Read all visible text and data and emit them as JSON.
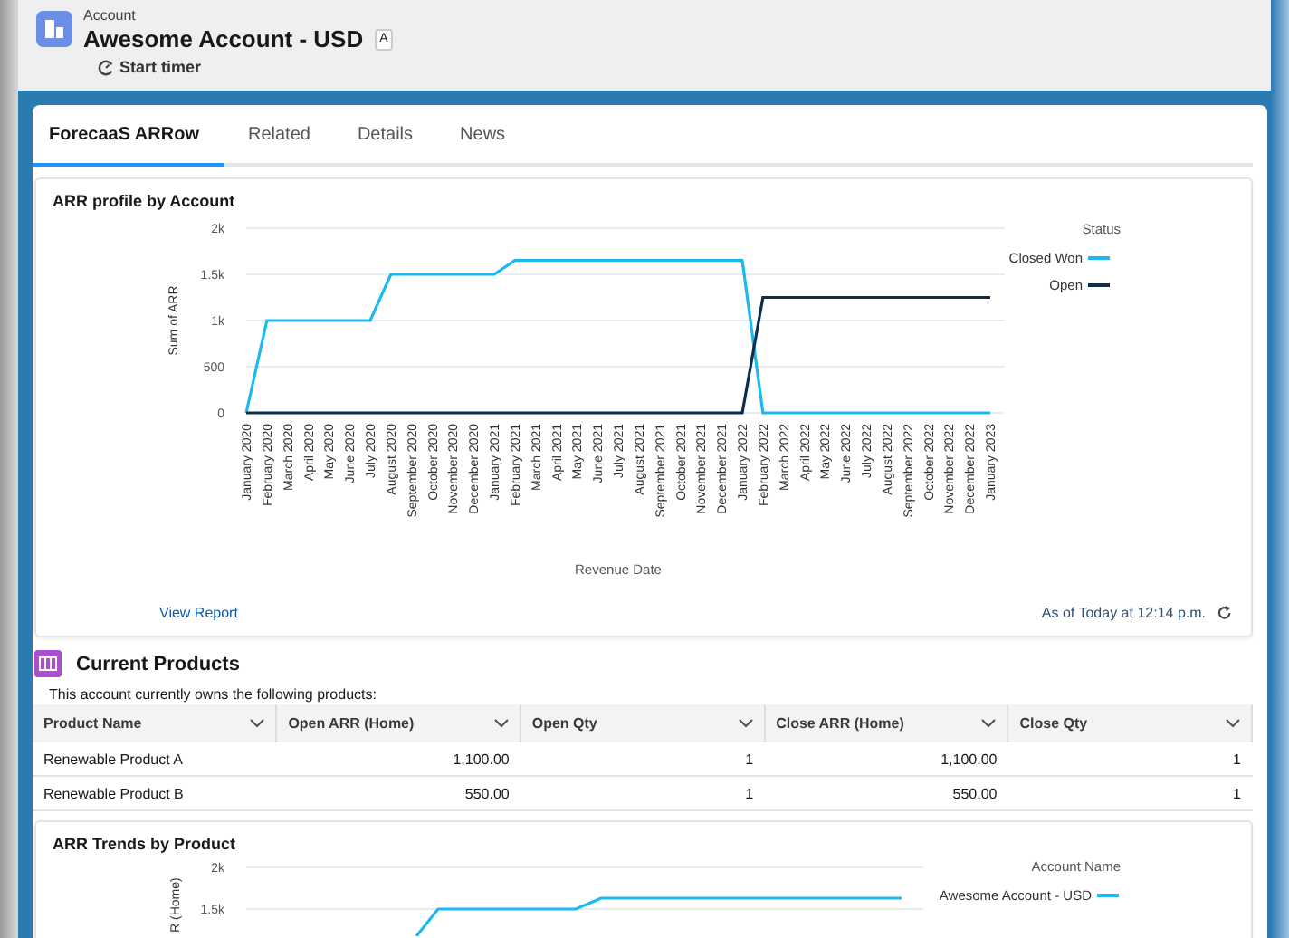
{
  "header": {
    "object_type": "Account",
    "title": "Awesome Account - USD",
    "badge": "A",
    "action": "Start timer"
  },
  "tabs": [
    {
      "label": "ForecaaS ARRow",
      "selected": true
    },
    {
      "label": "Related",
      "selected": false
    },
    {
      "label": "Details",
      "selected": false
    },
    {
      "label": "News",
      "selected": false
    }
  ],
  "arr_profile": {
    "title": "ARR profile by Account",
    "link": "View Report",
    "timestamp": "As of Today at 12:14 p.m.",
    "chart_data": {
      "type": "line",
      "grid": true,
      "legend": {
        "title": "Status"
      },
      "xlabel": "Revenue Date",
      "ylabel": "Sum of ARR",
      "categories": [
        "January 2020",
        "February 2020",
        "March 2020",
        "April 2020",
        "May 2020",
        "June 2020",
        "July 2020",
        "August 2020",
        "September 2020",
        "October 2020",
        "November 2020",
        "December 2020",
        "January 2021",
        "February 2021",
        "March 2021",
        "April 2021",
        "May 2021",
        "June 2021",
        "July 2021",
        "August 2021",
        "September 2021",
        "October 2021",
        "November 2021",
        "December 2021",
        "January 2022",
        "February 2022",
        "March 2022",
        "April 2022",
        "May 2022",
        "June 2022",
        "July 2022",
        "August 2022",
        "September 2022",
        "October 2022",
        "November 2022",
        "December 2022",
        "January 2023"
      ],
      "series": [
        {
          "name": "Closed Won",
          "color": "#1ab9f0",
          "values": [
            0,
            1000,
            1000,
            1000,
            1000,
            1000,
            1000,
            1500,
            1500,
            1500,
            1500,
            1500,
            1500,
            1650,
            1650,
            1650,
            1650,
            1650,
            1650,
            1650,
            1650,
            1650,
            1650,
            1650,
            1650,
            0,
            0,
            0,
            0,
            0,
            0,
            0,
            0,
            0,
            0,
            0,
            0
          ]
        },
        {
          "name": "Open",
          "color": "#0b2e4e",
          "values": [
            0,
            0,
            0,
            0,
            0,
            0,
            0,
            0,
            0,
            0,
            0,
            0,
            0,
            0,
            0,
            0,
            0,
            0,
            0,
            0,
            0,
            0,
            0,
            0,
            0,
            1250,
            1250,
            1250,
            1250,
            1250,
            1250,
            1250,
            1250,
            1250,
            1250,
            1250,
            1250
          ]
        }
      ],
      "ylim": [
        0,
        2000
      ],
      "yticks": [
        {
          "value": 0,
          "label": "0"
        },
        {
          "value": 500,
          "label": "500"
        },
        {
          "value": 1000,
          "label": "1k"
        },
        {
          "value": 1500,
          "label": "1.5k"
        },
        {
          "value": 2000,
          "label": "2k"
        }
      ]
    }
  },
  "current_products": {
    "title": "Current Products",
    "description": "This account currently owns the following products:",
    "columns": [
      "Product Name",
      "Open ARR (Home)",
      "Open Qty",
      "Close ARR (Home)",
      "Close Qty"
    ],
    "rows": [
      [
        "Renewable Product A",
        "1,100.00",
        "1",
        "1,100.00",
        "1"
      ],
      [
        "Renewable Product B",
        "550.00",
        "1",
        "550.00",
        "1"
      ]
    ]
  },
  "arr_trends": {
    "title": "ARR Trends by Product",
    "y_axis_labels": [
      "2k",
      "1.5k"
    ],
    "y_axis_title": "R (Home)",
    "legend_title": "Account Name",
    "legend": [
      "Awesome Account - USD"
    ]
  }
}
